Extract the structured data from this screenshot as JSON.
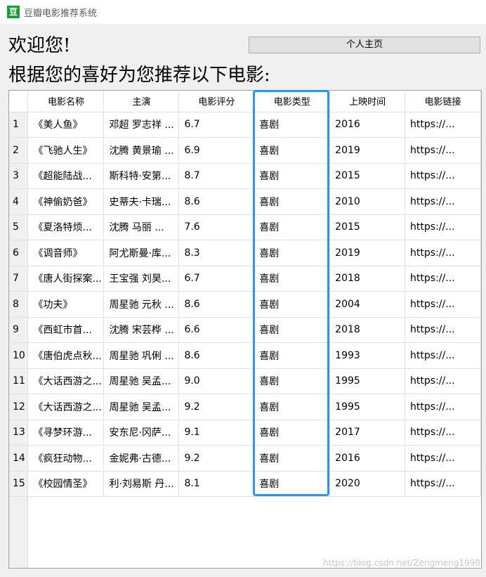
{
  "window": {
    "icon_text": "豆",
    "title": "豆瓣电影推荐系统"
  },
  "header": {
    "welcome": "欢迎您!",
    "recommend": "根据您的喜好为您推荐以下电影:",
    "profile_button": "个人主页"
  },
  "table": {
    "columns": [
      "电影名称",
      "主演",
      "电影评分",
      "电影类型",
      "上映时间",
      "电影链接"
    ],
    "rows": [
      [
        "1",
        "《美人鱼》",
        "邓超 罗志祥 ...",
        "6.7",
        "喜剧",
        "2016",
        "https://..."
      ],
      [
        "2",
        "《飞驰人生》",
        "沈腾 黄景瑜 ...",
        "6.9",
        "喜剧",
        "2019",
        "https://..."
      ],
      [
        "3",
        "《超能陆战...",
        "斯科特·安第...",
        "8.7",
        "喜剧",
        "2015",
        "https://..."
      ],
      [
        "4",
        "《神偷奶爸》",
        "史蒂夫·卡瑞...",
        "8.6",
        "喜剧",
        "2010",
        "https://..."
      ],
      [
        "5",
        "《夏洛特烦...",
        "沈腾 马丽 ...",
        "7.6",
        "喜剧",
        "2015",
        "https://..."
      ],
      [
        "6",
        "《调音师》",
        "阿尤斯曼·库...",
        "8.3",
        "喜剧",
        "2019",
        "https://..."
      ],
      [
        "7",
        "《唐人街探案...",
        "王宝强 刘昊...",
        "6.7",
        "喜剧",
        "2018",
        "https://..."
      ],
      [
        "8",
        "《功夫》",
        "周星驰 元秋 ...",
        "8.6",
        "喜剧",
        "2004",
        "https://..."
      ],
      [
        "9",
        "《西虹市首...",
        "沈腾 宋芸桦 ...",
        "6.6",
        "喜剧",
        "2018",
        "https://..."
      ],
      [
        "10",
        "《唐伯虎点秋...",
        "周星驰 巩俐 ...",
        "8.6",
        "喜剧",
        "1993",
        "https://..."
      ],
      [
        "11",
        "《大话西游之...",
        "周星驰 吴孟...",
        "9.0",
        "喜剧",
        "1995",
        "https://..."
      ],
      [
        "12",
        "《大话西游之...",
        "周星驰 吴孟...",
        "9.2",
        "喜剧",
        "1995",
        "https://..."
      ],
      [
        "13",
        "《寻梦环游...",
        "安东尼·冈萨...",
        "9.1",
        "喜剧",
        "2017",
        "https://..."
      ],
      [
        "14",
        "《疯狂动物...",
        "金妮弗·古德...",
        "9.2",
        "喜剧",
        "2016",
        "https://..."
      ],
      [
        "15",
        "《校园情圣》",
        "利·刘易斯 丹...",
        "8.1",
        "喜剧",
        "2020",
        "https://..."
      ]
    ]
  },
  "watermark": "https://blog.csdn.net/Zengmeng1998",
  "colors": {
    "highlight": "#2c95e8",
    "app_icon": "#1d9a3a"
  }
}
